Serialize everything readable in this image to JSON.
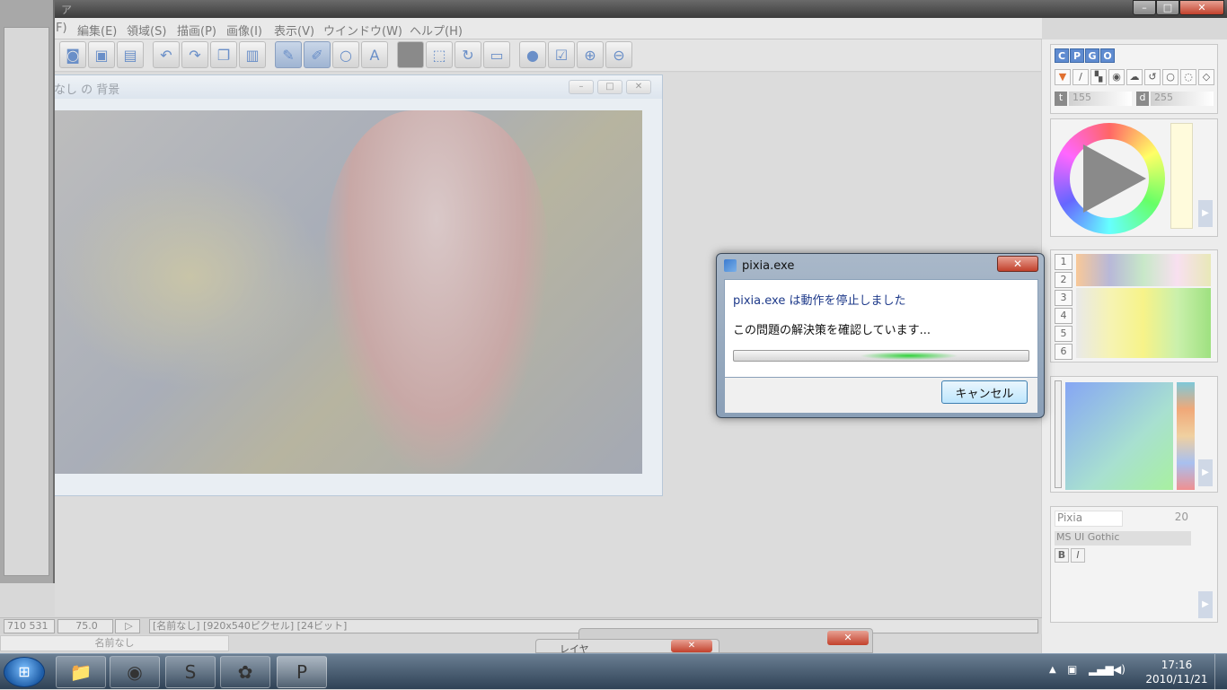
{
  "window": {
    "title_fragment": "ア"
  },
  "menubar": [
    {
      "label": "F)"
    },
    {
      "label": "編集(E)"
    },
    {
      "label": "領域(S)"
    },
    {
      "label": "描画(P)"
    },
    {
      "label": "画像(I)"
    },
    {
      "label": "表示(V)"
    },
    {
      "label": "ウインドウ(W)"
    },
    {
      "label": "ヘルプ(H)"
    }
  ],
  "document": {
    "title": "なし の 背景"
  },
  "dialog": {
    "title": "pixia.exe",
    "message": "pixia.exe は動作を停止しました",
    "detail": "この問題の解決策を確認しています...",
    "cancel_label": "キャンセル"
  },
  "right_panel": {
    "mode_tabs": [
      "C",
      "P",
      "G",
      "O"
    ],
    "t_label": "t",
    "t_value": "155",
    "d_label": "d",
    "d_value": "255",
    "palette_rows": [
      "1",
      "2",
      "3",
      "4",
      "5",
      "6"
    ],
    "font_name": "Pixia",
    "font_size": "20",
    "font_face": "MS UI Gothic",
    "bold_label": "B",
    "italic_label": "I"
  },
  "status": {
    "coords": "710 531",
    "zoom": "75.0",
    "info": "[名前なし] [920x540ピクセル] [24ビット]",
    "doc_name": "名前なし"
  },
  "background_windows": [
    {
      "title": "レイヤ"
    }
  ],
  "taskbar": {
    "apps": [
      "explorer-icon",
      "firefox-icon",
      "skype-icon",
      "app-icon",
      "pixia-icon"
    ],
    "time": "17:16",
    "date": "2010/11/21"
  },
  "colors": {
    "accent": "#5f8bd0",
    "close_red": "#c2412c"
  }
}
